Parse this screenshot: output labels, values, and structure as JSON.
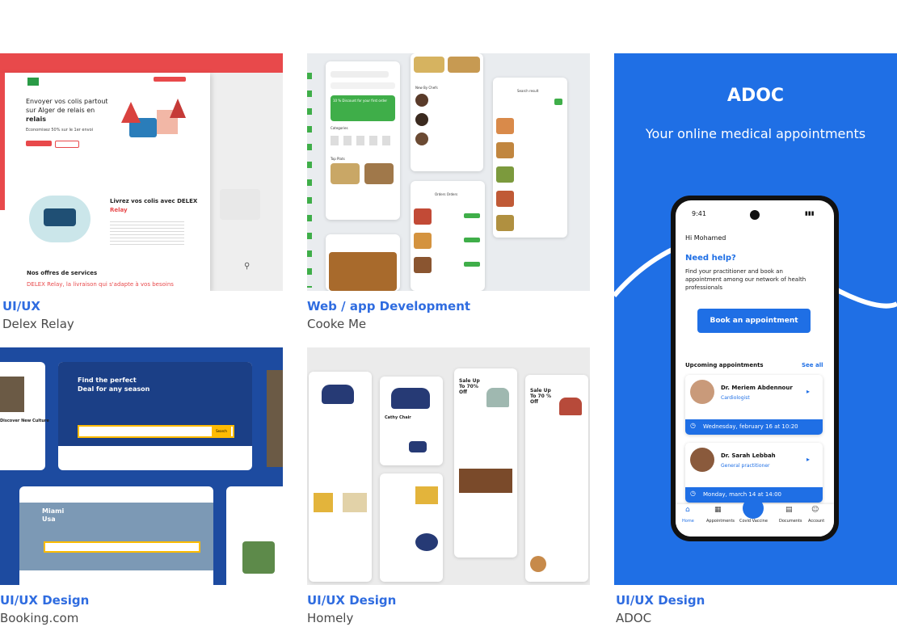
{
  "projects": [
    {
      "category": "UI/UX",
      "name": "Delex Relay"
    },
    {
      "category": "Web / app Development",
      "name": "Cooke Me"
    },
    {
      "category": "UI/UX Design",
      "name": "Booking.com"
    },
    {
      "category": "UI/UX Design",
      "name": "Homely"
    },
    {
      "category": "UI/UX Design",
      "name": "ADOC"
    }
  ],
  "delex": {
    "headline_1": "Envoyer vos colis partout",
    "headline_2": "sur Alger de relais en",
    "headline_3": "relais",
    "promo": "Economisez 50% sur le 1er envoi",
    "section_title_1": "Livrez vos colis avec DELEX",
    "section_title_2": "Relay",
    "services_title": "Nos offres de services",
    "services_sub": "DELEX Relay, la livraison qui s'adapte à vos besoins"
  },
  "cooke": {
    "promo": "10 % Discount for your first order",
    "categories": "Categories",
    "top_plats": "Top Plats",
    "search_result": "Search result",
    "orders": "Orders Orders",
    "new_by_chefs": "New By Chefs"
  },
  "booking": {
    "hero_title_1": "Find the perfect",
    "hero_title_2": "Deal for any season",
    "search_button": "Search",
    "city": "Miami",
    "country": "Usa",
    "discover": "Discover New Culture"
  },
  "homely": {
    "sale_1": "Sale Up To 70% Off",
    "sale_2": "Sale Up To 70 % Off",
    "product": "Cathy Chair"
  },
  "adoc": {
    "title": "ADOC",
    "subtitle": "Your online medical appointments",
    "status_time": "9:41",
    "greeting": "Hi Mohamed",
    "help_title": "Need help?",
    "help_text_1": "Find your practitioner and book an",
    "help_text_2": "appointment among our network of health",
    "help_text_3": "professionals",
    "book_button": "Book an appointment",
    "upcoming": "Upcoming appointments",
    "see_all": "See all",
    "appointments": [
      {
        "doctor": "Dr. Meriem Abdennour",
        "specialty": "Cardiologist",
        "date": "Wednesday, february 16 at 10:20"
      },
      {
        "doctor": "Dr. Sarah Lebbah",
        "specialty": "General practitioner",
        "date": "Monday, march 14 at 14:00"
      }
    ],
    "nav": [
      "Home",
      "Appointments",
      "Covid Vaccine",
      "Documents",
      "Account"
    ]
  },
  "colors": {
    "accent_blue": "#2f6ce0",
    "adoc_blue": "#1f6fe5",
    "delex_red": "#e8494b",
    "cooke_green": "#3fae49",
    "booking_navy": "#1b3f86"
  }
}
